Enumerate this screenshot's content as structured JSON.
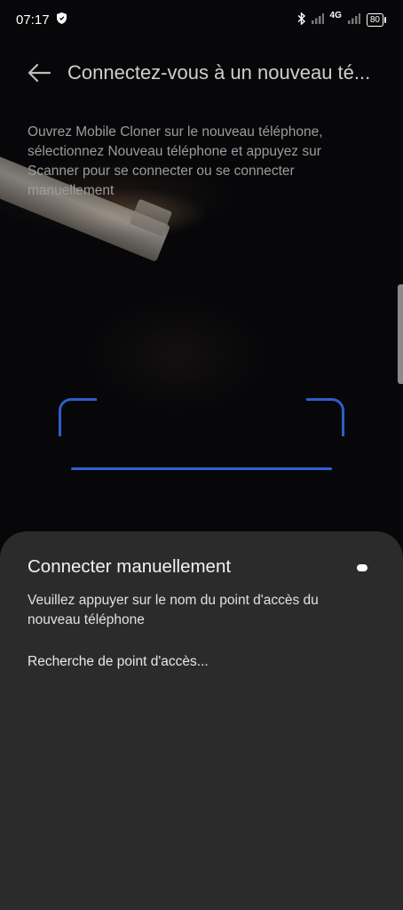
{
  "status_bar": {
    "time": "07:17",
    "network_label": "4G",
    "battery_level": "80",
    "icons": [
      "shield-icon",
      "bluetooth-icon",
      "signal-icon",
      "signal-icon",
      "battery-icon"
    ]
  },
  "header": {
    "back_icon": "arrow-left-icon",
    "title": "Connectez-vous à un nouveau té..."
  },
  "instructions": "Ouvrez Mobile Cloner sur le nouveau téléphone, sélectionnez Nouveau téléphone et appuyez sur Scanner pour se connecter ou se connecter manuellement",
  "scan": {
    "accent_color": "#2d5fc8"
  },
  "sheet": {
    "title": "Connecter manuellement",
    "description": "Veuillez appuyer sur le nom du point d'accès du nouveau téléphone",
    "search_status": "Recherche de point d'accès..."
  }
}
